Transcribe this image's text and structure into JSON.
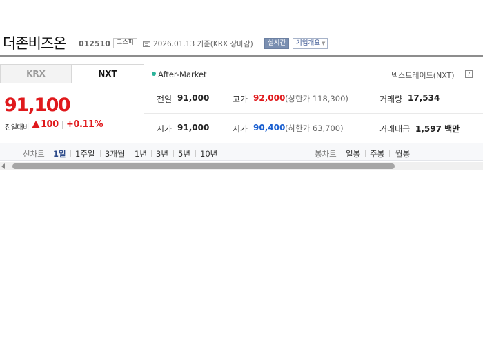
{
  "header": {
    "name": "더존비즈온",
    "code": "012510",
    "market": "코스피",
    "date_text": "2026.01.13 기준(KRX 장마감)",
    "realtime_label": "실시간",
    "company_label": "기업개요"
  },
  "tabs": [
    {
      "label": "KRX",
      "active": false
    },
    {
      "label": "NXT",
      "active": true
    }
  ],
  "quote": {
    "price": "91,100",
    "change_label": "전일대비",
    "change_amount": "100",
    "change_percent": "+0.11%",
    "direction": "up"
  },
  "session": {
    "label": "After-Market",
    "venue_label": "넥스트레이드(NXT)",
    "help_symbol": "?"
  },
  "stats": {
    "prev_close": {
      "label": "전일",
      "value": "91,000"
    },
    "high": {
      "label": "고가",
      "value": "92,000",
      "sub": "(상한가 118,300)"
    },
    "volume": {
      "label": "거래량",
      "value": "17,534"
    },
    "open": {
      "label": "시가",
      "value": "91,000"
    },
    "low": {
      "label": "저가",
      "value": "90,400",
      "sub": "(하한가 63,700)"
    },
    "amount": {
      "label": "거래대금",
      "value": "1,597 백만"
    }
  },
  "chart_bar": {
    "line_chart_label": "선차트",
    "line_periods": [
      "1일",
      "1주일",
      "3개월",
      "1년",
      "3년",
      "5년",
      "10년"
    ],
    "active_period": "1일",
    "candle_chart_label": "봉차트",
    "candle_periods": [
      "일봉",
      "주봉",
      "월봉"
    ]
  },
  "colors": {
    "up": "#e0191c",
    "down": "#1a5fd0",
    "active_link": "#2c4a8a"
  }
}
